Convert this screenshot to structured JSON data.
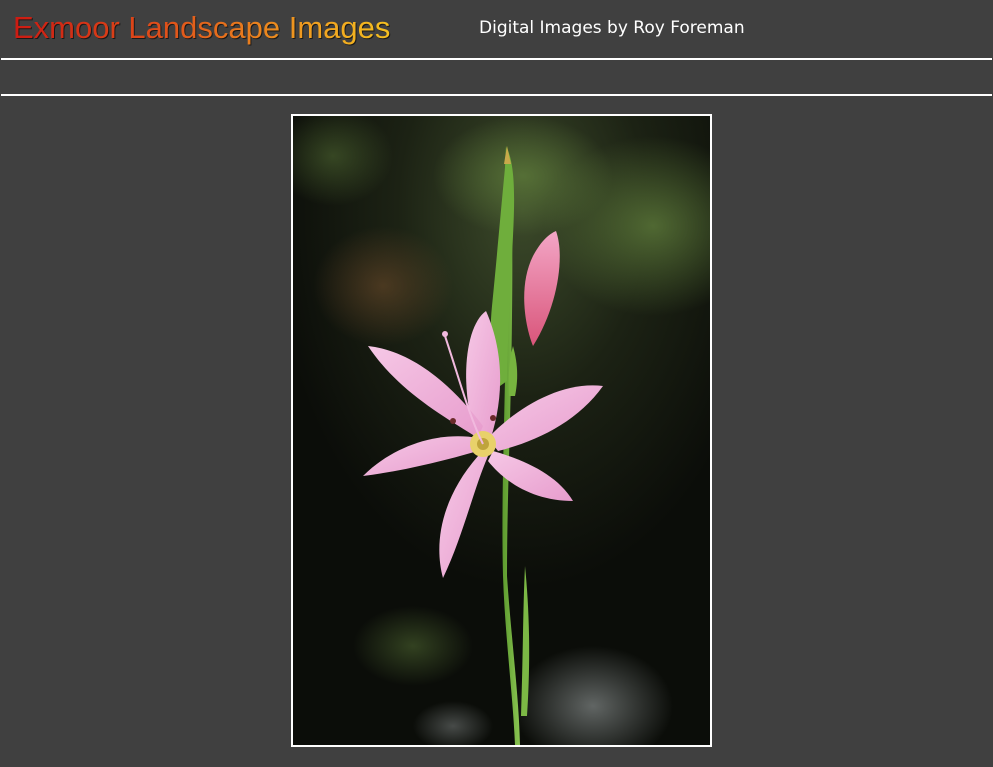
{
  "header": {
    "site_title": "Exmoor Landscape Images",
    "subtitle": "Digital Images by Roy Foreman"
  },
  "colors": {
    "page_background": "#404040",
    "title_gradient_start": "#cc1a12",
    "title_gradient_end": "#f5c020",
    "rule": "#ffffff"
  },
  "main_image": {
    "subject_icon": "pink-star-flower-photo"
  }
}
